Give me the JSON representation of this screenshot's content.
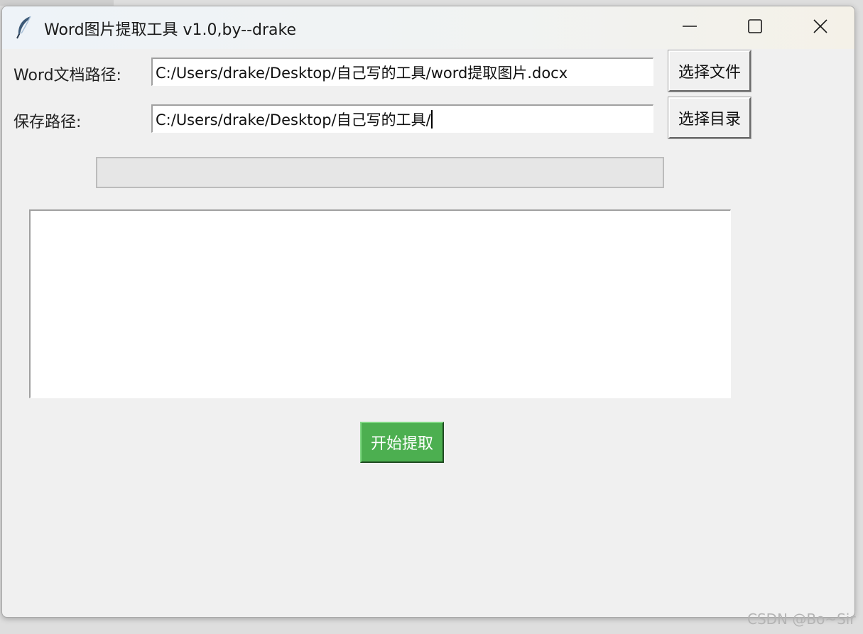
{
  "window": {
    "title": "Word图片提取工具 v1.0,by--drake",
    "icon": "feather-icon",
    "controls": {
      "minimize_icon": "minimize-icon",
      "maximize_icon": "maximize-icon",
      "close_icon": "close-icon"
    }
  },
  "form": {
    "doc_path_label": "Word文档路径:",
    "doc_path_value": "C:/Users/drake/Desktop/自己写的工具/word提取图片.docx",
    "select_file_button": "选择文件",
    "save_path_label": "保存路径:",
    "save_path_value": "C:/Users/drake/Desktop/自己写的工具/",
    "select_dir_button": "选择目录"
  },
  "progress": {
    "value": 0
  },
  "log": {
    "text": ""
  },
  "actions": {
    "start_button": "开始提取",
    "start_color": "#4caf50"
  },
  "watermark": "CSDN @Bo~Sir"
}
